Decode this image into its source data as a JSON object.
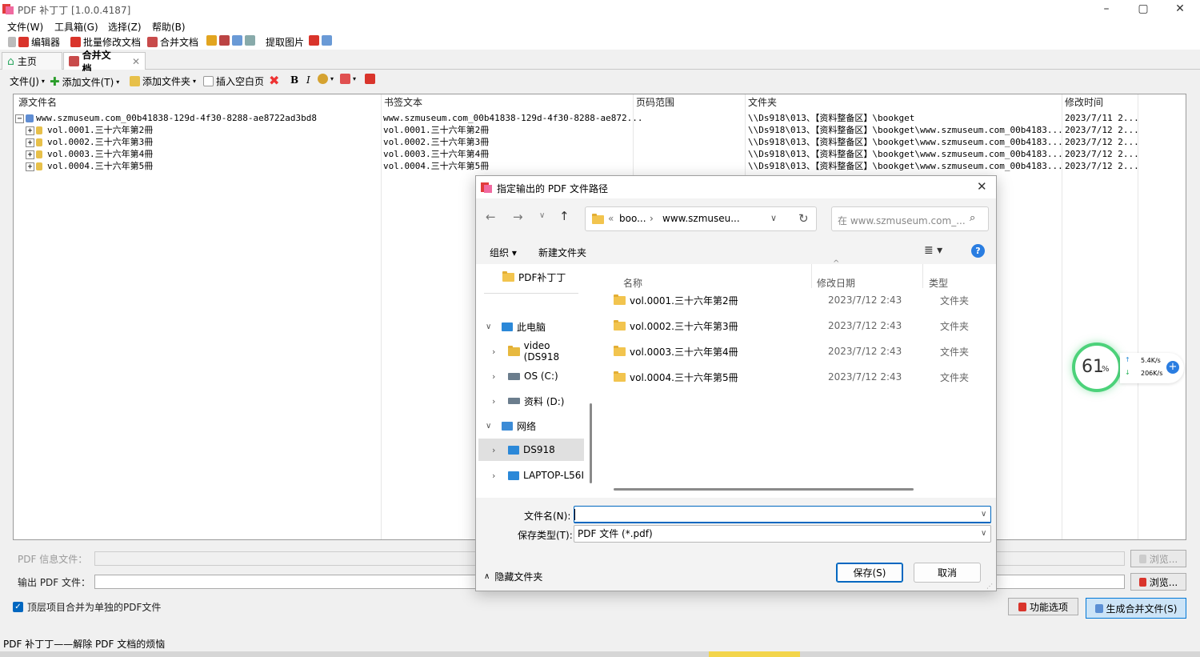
{
  "app": {
    "title": "PDF 补丁丁 [1.0.0.4187]"
  },
  "menu": [
    "文件(W)",
    "工具箱(G)",
    "选择(Z)",
    "帮助(B)"
  ],
  "toolbar": {
    "editor": "编辑器",
    "batch": "批量修改文档",
    "merge": "合并文档",
    "extract": "提取图片"
  },
  "tabs": {
    "home": "主页",
    "merge": "合并文档"
  },
  "toolbar2": {
    "file": "文件(J)",
    "add_file": "添加文件(T)",
    "add_folder": "添加文件夹",
    "insert_blank": "插入空白页",
    "bold": "B",
    "italic": "I"
  },
  "list": {
    "headers": [
      "源文件名",
      "书签文本",
      "页码范围",
      "文件夹",
      "修改时间"
    ],
    "rows": [
      {
        "expander": "−",
        "name": "www.szmuseum.com_00b41838-129d-4f30-8288-ae8722ad3bd8",
        "bookmark": "www.szmuseum.com_00b41838-129d-4f30-8288-ae872...",
        "range": "",
        "folder": "\\\\Ds918\\013、【资料整备区】\\bookget",
        "time": "2023/7/11 2..."
      },
      {
        "expander": "+",
        "name": "vol.0001.三十六年第2冊",
        "bookmark": "vol.0001.三十六年第2冊",
        "range": "",
        "folder": "\\\\Ds918\\013、【资料整备区】\\bookget\\www.szmuseum.com_00b4183...",
        "time": "2023/7/12 2..."
      },
      {
        "expander": "+",
        "name": "vol.0002.三十六年第3冊",
        "bookmark": "vol.0002.三十六年第3冊",
        "range": "",
        "folder": "\\\\Ds918\\013、【资料整备区】\\bookget\\www.szmuseum.com_00b4183...",
        "time": "2023/7/12 2..."
      },
      {
        "expander": "+",
        "name": "vol.0003.三十六年第4冊",
        "bookmark": "vol.0003.三十六年第4冊",
        "range": "",
        "folder": "\\\\Ds918\\013、【资料整备区】\\bookget\\www.szmuseum.com_00b4183...",
        "time": "2023/7/12 2..."
      },
      {
        "expander": "+",
        "name": "vol.0004.三十六年第5冊",
        "bookmark": "vol.0004.三十六年第5冊",
        "range": "",
        "folder": "\\\\Ds918\\013、【资料整备区】\\bookget\\www.szmuseum.com_00b4183...",
        "time": "2023/7/12 2..."
      }
    ]
  },
  "bottom": {
    "pdf_info_label": "PDF 信息文件：",
    "output_label": "输出 PDF 文件：",
    "browse1": "浏览...",
    "browse2": "浏览...",
    "checkbox_label": "顶层项目合并为单独的PDF文件",
    "options_btn": "功能选项",
    "generate_btn": "生成合并文件(S)"
  },
  "status": "PDF 补丁丁——解除 PDF 文档的烦恼",
  "dialog": {
    "title": "指定输出的 PDF 文件路径",
    "breadcrumb": [
      "«",
      "boo...",
      "›",
      "www.szmuseu..."
    ],
    "search_placeholder": "在 www.szmuseum.com_...",
    "organize": "组织 ▾",
    "new_folder": "新建文件夹",
    "nav": [
      {
        "label": "PDF补丁丁",
        "icon": "folder-icon"
      },
      {
        "label": "此电脑",
        "icon": "computer-icon"
      },
      {
        "label": "video (DS918",
        "icon": "folder-icon"
      },
      {
        "label": "OS (C:)",
        "icon": "drive-icon"
      },
      {
        "label": "资料 (D:)",
        "icon": "drive-icon"
      },
      {
        "label": "网络",
        "icon": "network-icon"
      },
      {
        "label": "DS918",
        "icon": "computer-icon"
      },
      {
        "label": "LAPTOP-L56I",
        "icon": "computer-icon"
      }
    ],
    "columns": {
      "name": "名称",
      "date": "修改日期",
      "type": "类型"
    },
    "files": [
      {
        "name": "vol.0001.三十六年第2冊",
        "date": "2023/7/12 2:43",
        "type": "文件夹"
      },
      {
        "name": "vol.0002.三十六年第3冊",
        "date": "2023/7/12 2:43",
        "type": "文件夹"
      },
      {
        "name": "vol.0003.三十六年第4冊",
        "date": "2023/7/12 2:43",
        "type": "文件夹"
      },
      {
        "name": "vol.0004.三十六年第5冊",
        "date": "2023/7/12 2:43",
        "type": "文件夹"
      }
    ],
    "filename_label": "文件名(N):",
    "filename_value": "",
    "filetype_label": "保存类型(T):",
    "filetype_value": "PDF 文件 (*.pdf)",
    "hide_folders": "隐藏文件夹",
    "save": "保存(S)",
    "cancel": "取消"
  },
  "speed_widget": {
    "percent": "61",
    "percent_unit": "%",
    "up": "5.4K/s",
    "down": "206K/s"
  }
}
